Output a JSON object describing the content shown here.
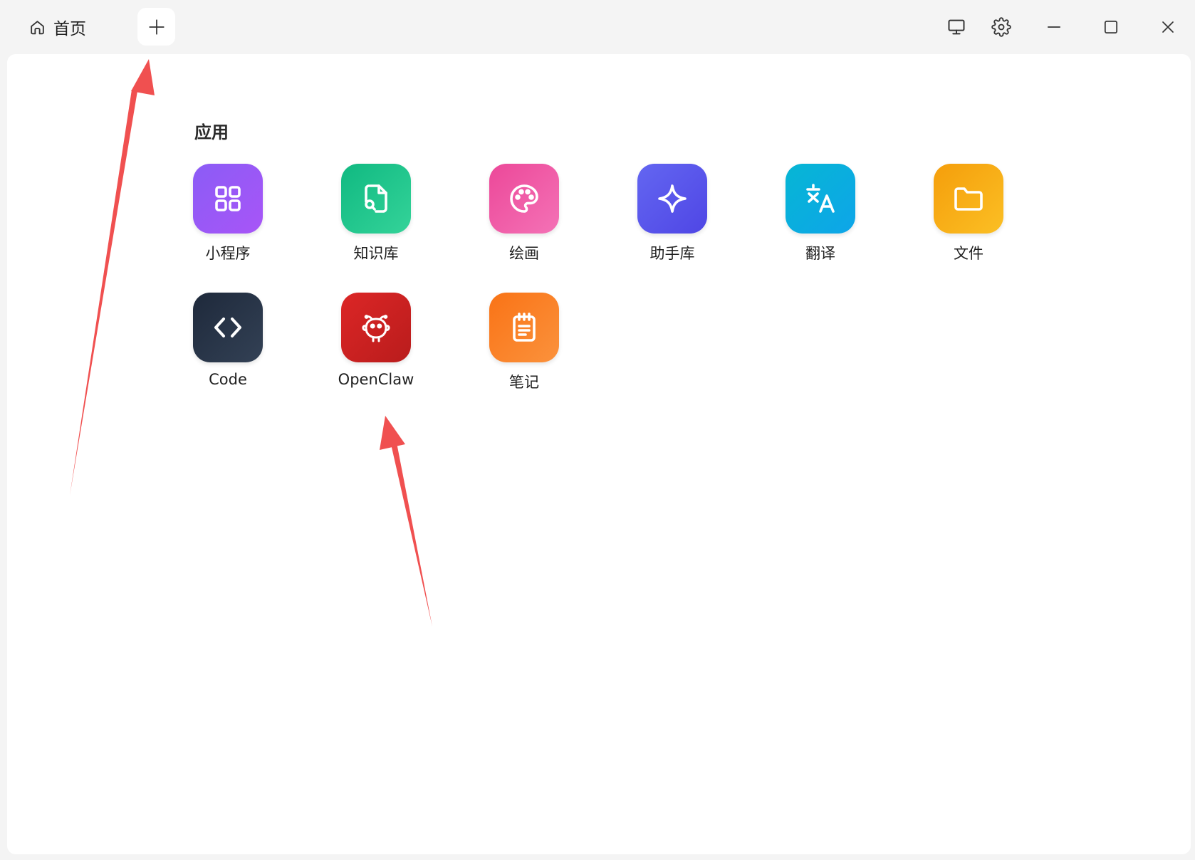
{
  "titlebar": {
    "home_tab_label": "首页",
    "home_icon": "home-icon",
    "new_tab_icon": "plus-icon",
    "controls": [
      "monitor-icon",
      "gear-icon",
      "minimize-icon",
      "maximize-icon",
      "close-icon"
    ]
  },
  "apps": {
    "section_title": "应用",
    "items": [
      {
        "label": "小程序",
        "icon": "grid-icon",
        "color_from": "#8b5cf6",
        "color_to": "#a855f7"
      },
      {
        "label": "知识库",
        "icon": "file-search-icon",
        "color_from": "#10b981",
        "color_to": "#34d399"
      },
      {
        "label": "绘画",
        "icon": "palette-icon",
        "color_from": "#ec4899",
        "color_to": "#f472b6"
      },
      {
        "label": "助手库",
        "icon": "sparkle-icon",
        "color_from": "#6366f1",
        "color_to": "#4f46e5"
      },
      {
        "label": "翻译",
        "icon": "translate-icon",
        "color_from": "#06b6d4",
        "color_to": "#0ea5e9"
      },
      {
        "label": "文件",
        "icon": "folder-icon",
        "color_from": "#f59e0b",
        "color_to": "#fbbf24"
      },
      {
        "label": "Code",
        "icon": "code-icon",
        "color_from": "#1e293b",
        "color_to": "#334155"
      },
      {
        "label": "OpenClaw",
        "icon": "openclaw-icon",
        "color_from": "#dc2626",
        "color_to": "#b91c1c"
      },
      {
        "label": "笔记",
        "icon": "notepad-icon",
        "color_from": "#f97316",
        "color_to": "#fb923c"
      }
    ]
  },
  "annotation_color": "#f05050"
}
